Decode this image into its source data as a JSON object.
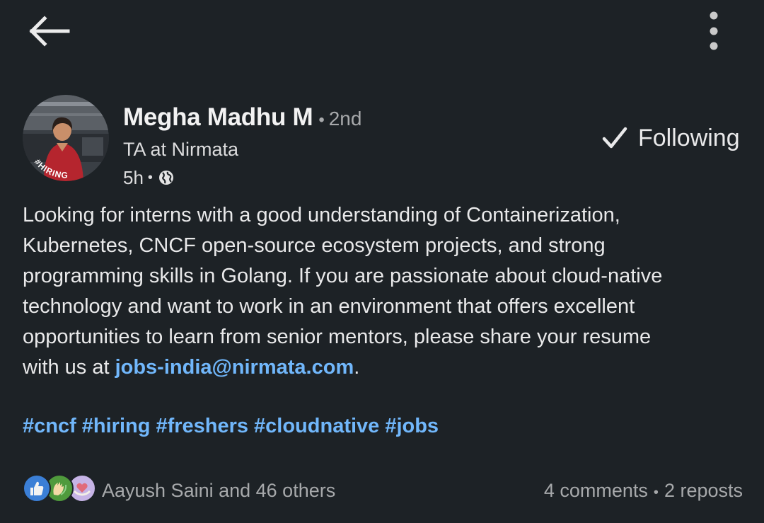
{
  "author": {
    "name": "Megha Madhu M",
    "connection_degree": "2nd",
    "headline": "TA at Nirmata",
    "posted_time": "5h",
    "avatar_badge": "#HIRING",
    "visibility_icon": "globe-icon"
  },
  "follow_button": {
    "label": "Following",
    "icon": "checkmark-icon"
  },
  "post": {
    "body_lines": [
      "Looking for interns with a good understanding of Containerization,",
      "Kubernetes, CNCF open-source ecosystem projects, and strong",
      "programming skills in Golang. If you are passionate about cloud-native",
      "technology and want to work in an environment that offers excellent",
      "opportunities to learn from senior mentors, please share your resume"
    ],
    "last_line_prefix": "with us at ",
    "email": "jobs-india@nirmata.com",
    "last_line_suffix": ".",
    "hashtags": [
      "#cncf",
      "#hiring",
      "#freshers",
      "#cloudnative",
      "#jobs"
    ]
  },
  "social": {
    "reaction_icons": [
      "like-icon",
      "celebrate-icon",
      "love-icon"
    ],
    "reactions_text": "Aayush Saini and 46 others",
    "comments": "4 comments",
    "reposts": "2 reposts"
  },
  "colors": {
    "background": "#1d2226",
    "link": "#71b7fb",
    "muted_text": "#a7a9ab",
    "primary_text": "#e9e9ea",
    "hiring_frame": "#7a3fd0"
  }
}
